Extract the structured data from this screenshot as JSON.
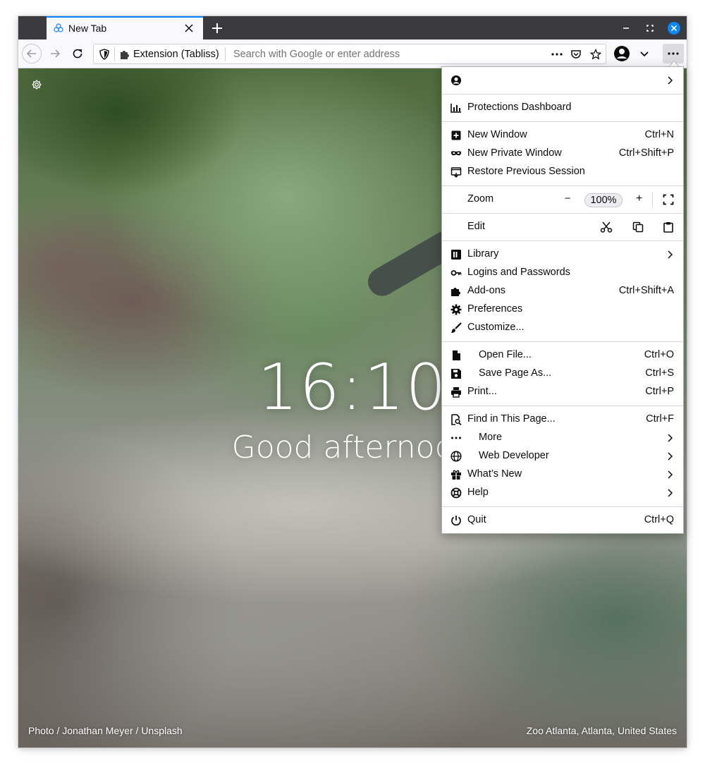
{
  "tab": {
    "title": "New Tab"
  },
  "urlbar": {
    "identity": "Extension (Tabliss)",
    "placeholder": "Search with Google or enter address"
  },
  "page": {
    "time": "16:10",
    "greeting": "Good afternoon",
    "photo_credit": "Photo / Jonathan Meyer / Unsplash",
    "location": "Zoo Atlanta, Atlanta, United States"
  },
  "menu": {
    "account_label": "",
    "protections": "Protections Dashboard",
    "new_window": "New Window",
    "new_window_sc": "Ctrl+N",
    "new_private": "New Private Window",
    "new_private_sc": "Ctrl+Shift+P",
    "restore": "Restore Previous Session",
    "zoom": "Zoom",
    "zoom_minus": "−",
    "zoom_value": "100%",
    "zoom_plus": "+",
    "edit": "Edit",
    "library": "Library",
    "logins": "Logins and Passwords",
    "addons": "Add-ons",
    "addons_sc": "Ctrl+Shift+A",
    "preferences": "Preferences",
    "customize": "Customize...",
    "open_file": "Open File...",
    "open_file_sc": "Ctrl+O",
    "save_page": "Save Page As...",
    "save_page_sc": "Ctrl+S",
    "print": "Print...",
    "print_sc": "Ctrl+P",
    "find": "Find in This Page...",
    "find_sc": "Ctrl+F",
    "more": "More",
    "web_dev": "Web Developer",
    "whats_new": "What’s New",
    "help": "Help",
    "quit": "Quit",
    "quit_sc": "Ctrl+Q"
  },
  "colors": {
    "accent": "#0a84ff",
    "close_button": "#0a84ff"
  }
}
